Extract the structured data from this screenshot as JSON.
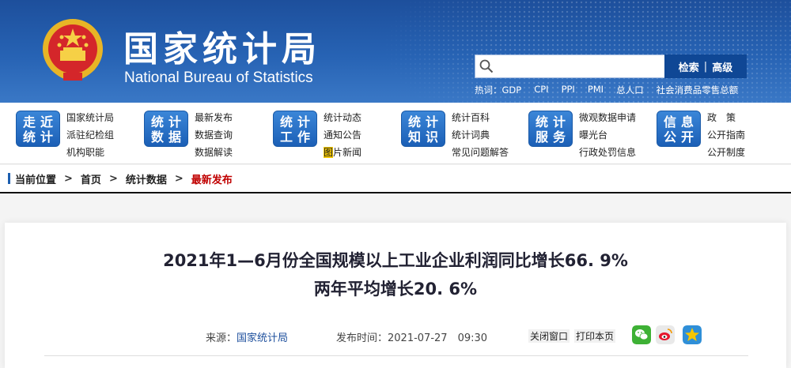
{
  "header": {
    "title_cn": "国家统计局",
    "title_en": "National Bureau of Statistics",
    "search": {
      "placeholder": "",
      "button_search": "检索",
      "button_advanced": "高级"
    },
    "hot_words": [
      "热词：GDP",
      "CPI",
      "PPI",
      "PMI",
      "总人口",
      "社会消费品零售总额"
    ]
  },
  "nav": [
    {
      "badge": [
        "走近",
        "统计"
      ],
      "links": [
        "国家统计局",
        "派驻纪检组",
        "机构职能"
      ]
    },
    {
      "badge": [
        "统计",
        "数据"
      ],
      "links": [
        "最新发布",
        "数据查询",
        "数据解读"
      ]
    },
    {
      "badge": [
        "统计",
        "工作"
      ],
      "links": [
        "统计动态",
        "通知公告",
        "图片新闻"
      ]
    },
    {
      "badge": [
        "统计",
        "知识"
      ],
      "links": [
        "统计百科",
        "统计词典",
        "常见问题解答"
      ]
    },
    {
      "badge": [
        "统计",
        "服务"
      ],
      "links": [
        "微观数据申请",
        "曝光台",
        "行政处罚信息"
      ]
    },
    {
      "badge": [
        "信息",
        "公开"
      ],
      "links": [
        "政　策",
        "公开指南",
        "公开制度"
      ]
    }
  ],
  "breadcrumb": {
    "label": "当前位置",
    "items": [
      "首页",
      "统计数据",
      "最新发布"
    ],
    "separator": ">"
  },
  "article": {
    "title_line1": "2021年1—6月份全国规模以上工业企业利润同比增长66. 9%",
    "title_line2": "两年平均增长20. 6%",
    "source_label": "来源：",
    "source": "国家统计局",
    "time_label": "发布时间：",
    "time": "2021-07-27　09:30",
    "close_window": "关闭窗口",
    "print_page": "打印本页"
  },
  "colors": {
    "header_blue": "#1d4f9c",
    "accent_red": "#c00000",
    "badge_blue": "#1b5fb6"
  },
  "icons": [
    "national-emblem",
    "search-icon",
    "wechat-icon",
    "weibo-icon",
    "qzone-icon"
  ]
}
